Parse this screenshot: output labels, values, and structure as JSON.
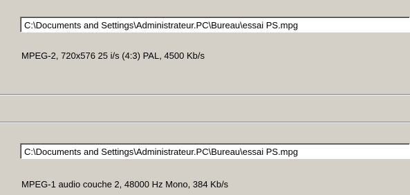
{
  "video": {
    "file_path": "C:\\Documents and Settings\\Administrateur.PC\\Bureau\\essai PS.mpg",
    "info": "MPEG-2, 720x576 25 i/s (4:3) PAL, 4500 Kb/s"
  },
  "audio": {
    "file_path": "C:\\Documents and Settings\\Administrateur.PC\\Bureau\\essai PS.mpg",
    "info": "MPEG-1 audio couche 2, 48000 Hz Mono, 384 Kb/s"
  },
  "colors": {
    "dialog_background": "#d4d0c8",
    "field_background": "#ffffff",
    "shadow": "#808080",
    "highlight": "#ffffff"
  }
}
